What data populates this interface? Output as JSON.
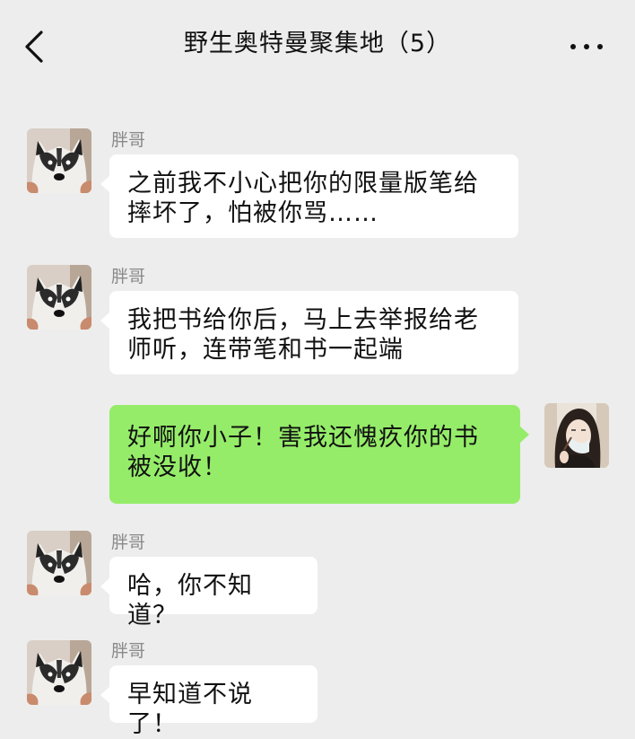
{
  "header": {
    "title": "野生奥特曼聚集地（5）",
    "back_icon": "chevron-left-icon",
    "more_icon": "more-dots-icon"
  },
  "colors": {
    "background": "#ededed",
    "incoming_bubble": "#ffffff",
    "outgoing_bubble": "#95ec69"
  },
  "messages": [
    {
      "sender": "胖哥",
      "direction": "incoming",
      "text": "之前我不小心把你的限量版笔给摔坏了，怕被你骂……"
    },
    {
      "sender": "胖哥",
      "direction": "incoming",
      "text": "我把书给你后，马上去举报给老师听，连带笔和书一起端"
    },
    {
      "sender": "",
      "direction": "outgoing",
      "text": "好啊你小子！害我还愧疚你的书被没收！"
    },
    {
      "sender": "胖哥",
      "direction": "incoming",
      "text": "哈，你不知道？"
    },
    {
      "sender": "胖哥",
      "direction": "incoming",
      "text": "早知道不说了！"
    }
  ]
}
